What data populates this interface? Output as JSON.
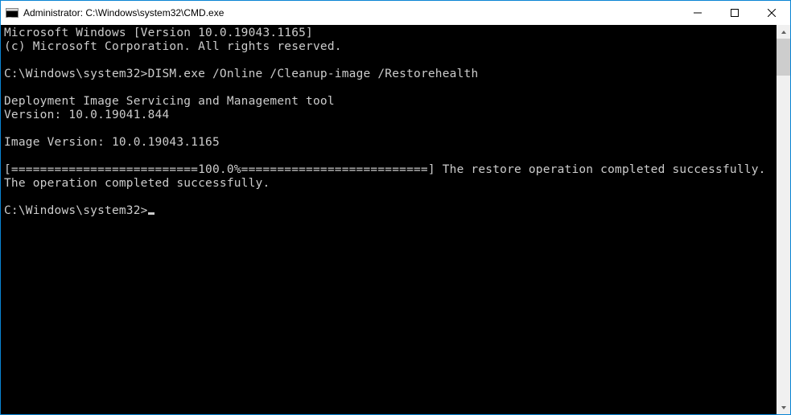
{
  "titlebar": {
    "title": "Administrator: C:\\Windows\\system32\\CMD.exe"
  },
  "terminal": {
    "line1": "Microsoft Windows [Version 10.0.19043.1165]",
    "line2": "(c) Microsoft Corporation. All rights reserved.",
    "blank1": "",
    "prompt1_path": "C:\\Windows\\system32>",
    "prompt1_cmd": "DISM.exe /Online /Cleanup-image /Restorehealth",
    "blank2": "",
    "tool_line": "Deployment Image Servicing and Management tool",
    "version_line": "Version: 10.0.19041.844",
    "blank3": "",
    "image_version_line": "Image Version: 10.0.19043.1165",
    "blank4": "",
    "progress_line": "[==========================100.0%==========================] The restore operation completed successfully.",
    "complete_line": "The operation completed successfully.",
    "blank5": "",
    "prompt2_path": "C:\\Windows\\system32>"
  }
}
